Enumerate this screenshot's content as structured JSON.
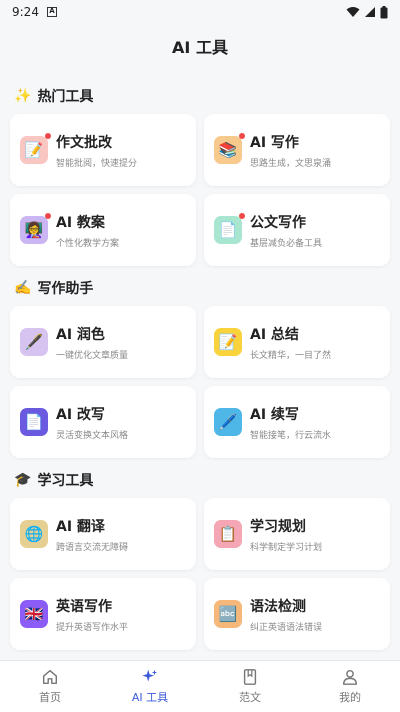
{
  "status_bar": {
    "time": "9:24",
    "notif_letter": "A"
  },
  "header": {
    "title": "AI 工具"
  },
  "sections": [
    {
      "emoji": "✨",
      "title": "热门工具",
      "items": [
        {
          "title": "作文批改",
          "subtitle": "智能批阅，快速提分",
          "icon": "pencil-note-icon",
          "glyph": "📝",
          "bg": "#f9c6c2",
          "dot": true
        },
        {
          "title": "AI 写作",
          "subtitle": "思路生成，文思泉涌",
          "icon": "books-icon",
          "glyph": "📚",
          "bg": "#f7c98c",
          "dot": true
        },
        {
          "title": "AI 教案",
          "subtitle": "个性化教学方案",
          "icon": "teacher-icon",
          "glyph": "👩‍🏫",
          "bg": "#c9b6f2",
          "dot": true
        },
        {
          "title": "公文写作",
          "subtitle": "基层减负必备工具",
          "icon": "document-icon",
          "glyph": "📄",
          "bg": "#a8e6cf",
          "dot": true
        }
      ]
    },
    {
      "emoji": "✍️",
      "title": "写作助手",
      "items": [
        {
          "title": "AI 润色",
          "subtitle": "一键优化文章质量",
          "icon": "fountain-pen-icon",
          "glyph": "🖋️",
          "bg": "#d7c3f0",
          "dot": false
        },
        {
          "title": "AI 总结",
          "subtitle": "长文精华，一目了然",
          "icon": "memo-icon",
          "glyph": "📝",
          "bg": "#f9d23c",
          "dot": false
        },
        {
          "title": "AI 改写",
          "subtitle": "灵活变换文本风格",
          "icon": "page-icon",
          "glyph": "📄",
          "bg": "#6a5ae0",
          "dot": false
        },
        {
          "title": "AI 续写",
          "subtitle": "智能接笔，行云流水",
          "icon": "pen-icon",
          "glyph": "🖊️",
          "bg": "#4fb6e8",
          "dot": false
        }
      ]
    },
    {
      "emoji": "🎓",
      "title": "学习工具",
      "items": [
        {
          "title": "AI 翻译",
          "subtitle": "跨语言交流无障碍",
          "icon": "globe-icon",
          "glyph": "🌐",
          "bg": "#e6cf92",
          "dot": false
        },
        {
          "title": "学习规划",
          "subtitle": "科学制定学习计划",
          "icon": "clipboard-icon",
          "glyph": "📋",
          "bg": "#f4a6b5",
          "dot": false
        },
        {
          "title": "英语写作",
          "subtitle": "提升英语写作水平",
          "icon": "uk-flag-icon",
          "glyph": "🇬🇧",
          "bg": "#8b5cf6",
          "dot": false
        },
        {
          "title": "语法检测",
          "subtitle": "纠正英语语法错误",
          "icon": "abc-icon",
          "glyph": "🔤",
          "bg": "#f5b87a",
          "dot": false
        }
      ]
    }
  ],
  "tabbar": {
    "active_color": "#3b5bdb",
    "tabs": [
      {
        "label": "首页",
        "icon": "home-icon",
        "active": false
      },
      {
        "label": "AI 工具",
        "icon": "sparkle-icon",
        "active": true
      },
      {
        "label": "范文",
        "icon": "book-icon",
        "active": false
      },
      {
        "label": "我的",
        "icon": "user-icon",
        "active": false
      }
    ]
  }
}
